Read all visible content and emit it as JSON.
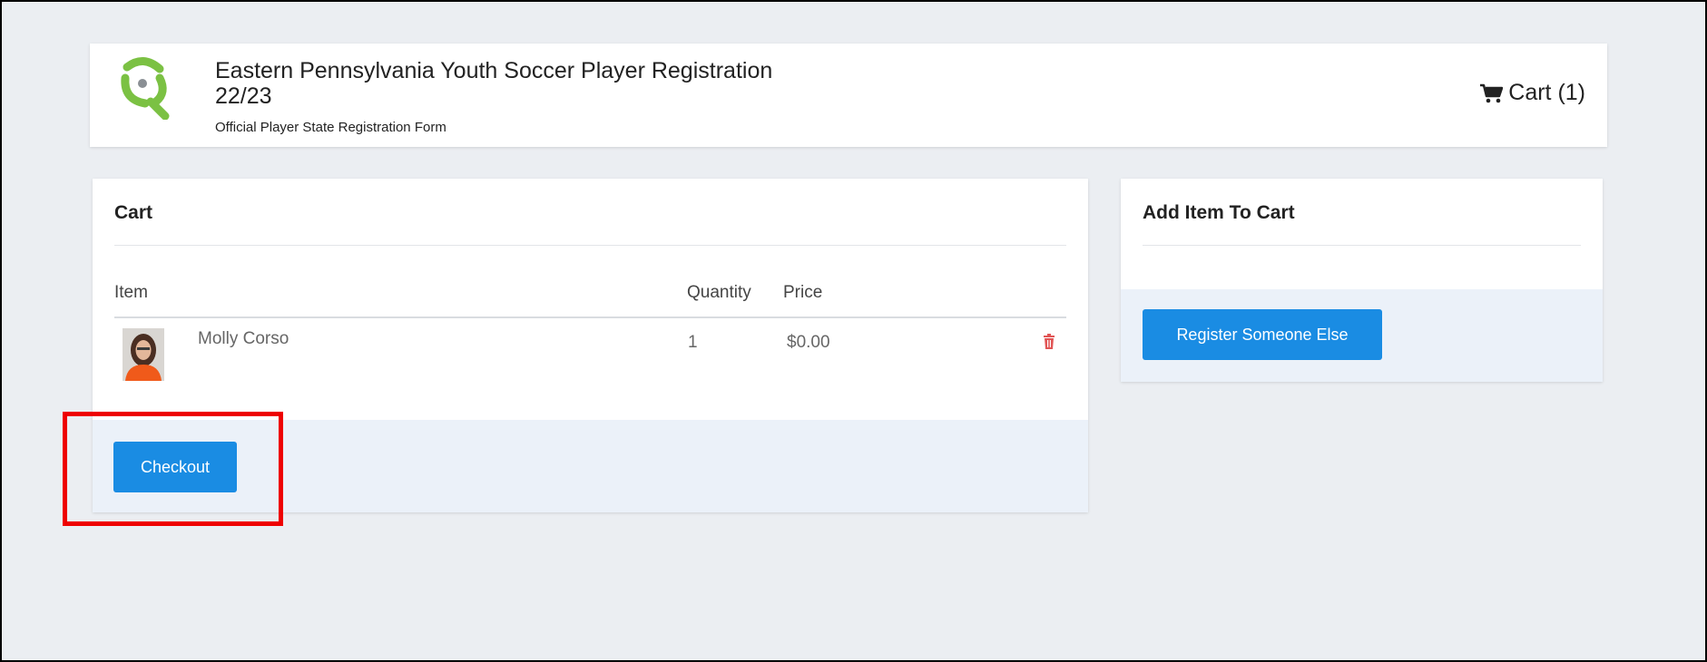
{
  "header": {
    "title_line1": "Eastern Pennsylvania Youth Soccer Player Registration",
    "title_line2": "22/23",
    "subtitle": "Official Player State Registration Form",
    "cart_label": "Cart (1)",
    "logo_icon": "soccer-logo-icon"
  },
  "cart": {
    "title": "Cart",
    "columns": {
      "item": "Item",
      "quantity": "Quantity",
      "price": "Price"
    },
    "rows": [
      {
        "name": "Molly Corso",
        "quantity": "1",
        "price": "$0.00"
      }
    ],
    "checkout_label": "Checkout"
  },
  "add_item": {
    "title": "Add Item To Cart",
    "register_label": "Register Someone Else"
  },
  "colors": {
    "accent": "#1a8ce3",
    "logo_green": "#7bc143",
    "delete_red": "#e15555",
    "highlight_red": "#ee0000",
    "page_bg": "#ebeef2"
  }
}
